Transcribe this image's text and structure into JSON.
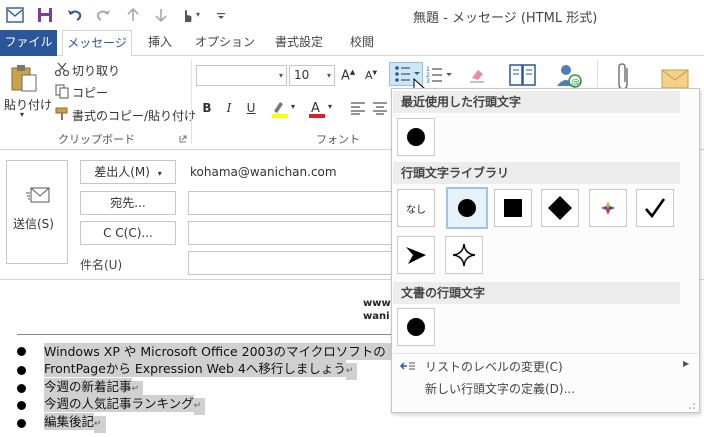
{
  "window": {
    "title": "無題 - メッセージ (HTML 形式)"
  },
  "tabs": [
    {
      "label": "ファイル"
    },
    {
      "label": "メッセージ"
    },
    {
      "label": "挿入"
    },
    {
      "label": "オプション"
    },
    {
      "label": "書式設定"
    },
    {
      "label": "校閲"
    }
  ],
  "clipboard": {
    "paste_label": "貼り付け",
    "cut_label": "切り取り",
    "copy_label": "コピー",
    "format_painter_label": "書式のコピー/貼り付け",
    "group_label": "クリップボード"
  },
  "font": {
    "font_name": "",
    "font_size": "10",
    "group_label": "フォント",
    "bold": "B",
    "italic": "I",
    "underline": "U"
  },
  "header": {
    "send_label": "送信(S)",
    "from_label": "差出人(M)",
    "from_value": "kohama@wanichan.com",
    "to_label": "宛先...",
    "cc_label": "C C(C)...",
    "subject_label": "件名(U)"
  },
  "body": {
    "partial_text_1": "www",
    "partial_text_2": "wani",
    "lines": [
      "Windows XP や Microsoft Office 2003のマイクロソフトの",
      "FrontPageから Expression Web 4へ移行しましょう",
      "今週の新着記事",
      "今週の人気記事ランキング",
      "編集後記"
    ]
  },
  "bullet_menu": {
    "recent_heading": "最近使用した行頭文字",
    "library_heading": "行頭文字ライブラリ",
    "document_heading": "文書の行頭文字",
    "none_label": "なし",
    "change_level_label": "リストのレベルの変更(C)",
    "define_new_label": "新しい行頭文字の定義(D)..."
  },
  "colors": {
    "accent": "#2b579a",
    "selection_highlight": "#d0d0d0",
    "selected_tile_border": "#9bc6ea"
  }
}
